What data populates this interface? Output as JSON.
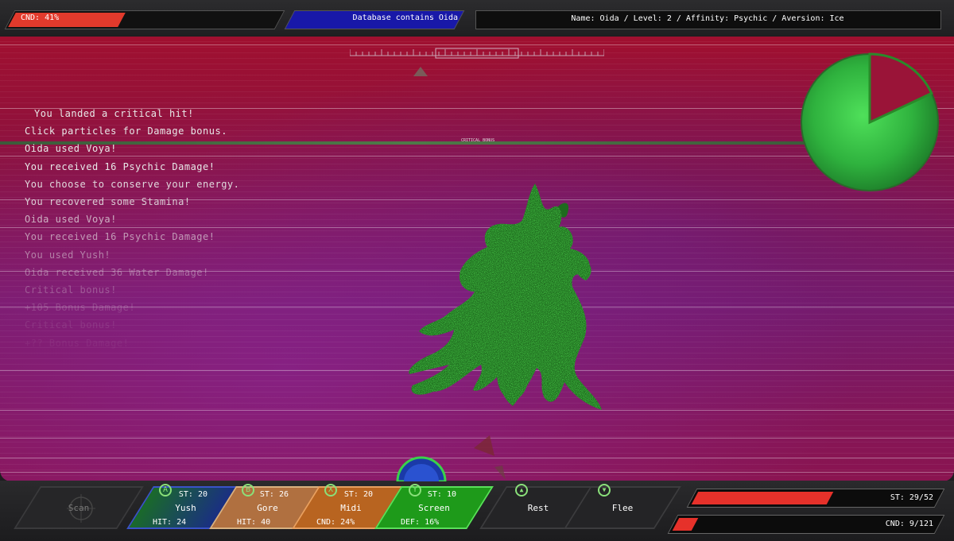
{
  "hud": {
    "condition_label": "CND: 41%",
    "condition_fraction": 0.41,
    "database_text": "Database contains Oida",
    "enemy_info": "Name: Oida / Level: 2 / Affinity: Psychic / Aversion: Ice"
  },
  "arena": {
    "critical_bonus_label": "CRITICAL BONUS",
    "radar_remaining_fraction": 0.82
  },
  "battle_log": [
    {
      "text": "You landed a critical hit!",
      "opacity": 1.0
    },
    {
      "text": "Click particles for Damage bonus.",
      "opacity": 1.0
    },
    {
      "text": "Oida used Voya!",
      "opacity": 1.0
    },
    {
      "text": "You received 16 Psychic Damage!",
      "opacity": 1.0
    },
    {
      "text": "You choose to conserve your energy.",
      "opacity": 0.92
    },
    {
      "text": "You recovered some Stamina!",
      "opacity": 0.86
    },
    {
      "text": "Oida used Voya!",
      "opacity": 0.72
    },
    {
      "text": "You received 16 Psychic Damage!",
      "opacity": 0.6
    },
    {
      "text": "You used Yush!",
      "opacity": 0.48
    },
    {
      "text": "Oida received 36 Water Damage!",
      "opacity": 0.38
    },
    {
      "text": "Critical bonus!",
      "opacity": 0.28
    },
    {
      "text": "+105 Bonus Damage!",
      "opacity": 0.18
    },
    {
      "text": "Critical bonus!",
      "opacity": 0.1
    },
    {
      "text": "+?? Bonus Damage!",
      "opacity": 0.06
    }
  ],
  "actions": {
    "scan": {
      "label": "Scan"
    },
    "yush": {
      "button": "A",
      "label": "Yush",
      "st": "ST: 20",
      "sub": "HIT: 24",
      "color": "#1a2a8a"
    },
    "gore": {
      "button": "B",
      "label": "Gore",
      "st": "ST: 26",
      "sub": "HIT: 40",
      "color": "#b07040"
    },
    "midi": {
      "button": "X",
      "label": "Midi",
      "st": "ST: 20",
      "sub": "CND: 24%",
      "color": "#b86420"
    },
    "screen": {
      "button": "Y",
      "label": "Screen",
      "st": "ST: 10",
      "sub": "DEF: 16%",
      "color": "#1e9a1a"
    },
    "rest": {
      "label": "Rest"
    },
    "flee": {
      "label": "Flee"
    }
  },
  "player": {
    "stamina_label": "ST: 29/52",
    "stamina_fraction": 0.558,
    "condition_label": "CND: 9/121",
    "condition_fraction": 0.074
  }
}
